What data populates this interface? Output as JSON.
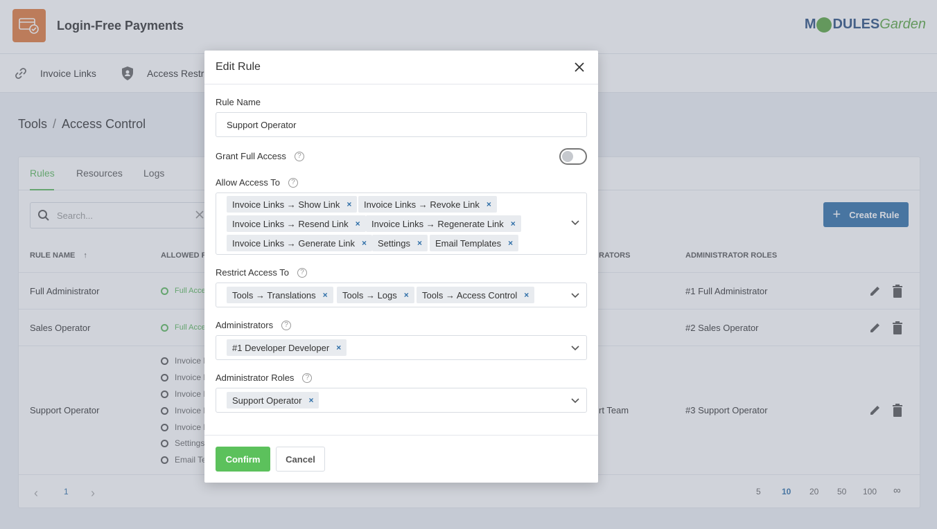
{
  "app": {
    "title": "Login-Free Payments",
    "brand_part1": "M",
    "brand_part2": "DULES",
    "brand_part3": "Garden"
  },
  "nav": {
    "items": [
      {
        "label": "Invoice Links",
        "icon": "link-icon"
      },
      {
        "label": "Access Restr",
        "icon": "shield-user-icon"
      }
    ]
  },
  "breadcrumb": {
    "root": "Tools",
    "separator": "/",
    "current": "Access Control"
  },
  "tabs": [
    "Rules",
    "Resources",
    "Logs"
  ],
  "toolbar": {
    "search_placeholder": "Search...",
    "create_label": "Create Rule"
  },
  "table": {
    "headers": {
      "rule_name": "RULE NAME",
      "sort_arrow": "↑",
      "allowed": "ALLOWED RE",
      "administrators": "RATORS",
      "admin_roles": "ADMINISTRATOR ROLES"
    },
    "rows": [
      {
        "name": "Full Administrator",
        "allowed": "Full Acce",
        "admins": "",
        "roles": "#1 Full Administrator"
      },
      {
        "name": "Sales Operator",
        "allowed": "Full Acce",
        "admins": "",
        "roles": "#2 Sales Operator"
      },
      {
        "name": "Support Operator",
        "allowed_list": [
          "Invoice L",
          "Invoice L",
          "Invoice L",
          "Invoice L",
          "Invoice L",
          "Settings",
          "Email Te"
        ],
        "admins": "rt Team",
        "roles": "#3 Support Operator"
      }
    ]
  },
  "pagination": {
    "current": "1",
    "per_page": [
      "5",
      "10",
      "20",
      "50",
      "100",
      "∞"
    ],
    "active_per_page": "10"
  },
  "modal": {
    "title": "Edit Rule",
    "rule_name_label": "Rule Name",
    "rule_name_value": "Support Operator",
    "grant_label": "Grant Full Access",
    "grant_value": false,
    "allow_label": "Allow Access To",
    "allow_chips": [
      "Invoice Links → Show Link",
      "Invoice Links → Revoke Link",
      "Invoice Links → Resend Link",
      "Invoice Links → Regenerate Link",
      "Invoice Links → Generate Link",
      "Settings",
      "Email Templates"
    ],
    "restrict_label": "Restrict Access To",
    "restrict_chips": [
      "Tools → Translations",
      "Tools → Logs",
      "Tools → Access Control"
    ],
    "admins_label": "Administrators",
    "admins_chips": [
      "#1 Developer Developer"
    ],
    "roles_label": "Administrator Roles",
    "roles_chips": [
      "Support Operator"
    ],
    "help_glyph": "?",
    "remove_glyph": "×",
    "confirm_label": "Confirm",
    "cancel_label": "Cancel"
  },
  "colors": {
    "accent_green": "#5cb85c",
    "primary_blue": "#2f6fa8",
    "logo_orange": "#e07a3c"
  }
}
